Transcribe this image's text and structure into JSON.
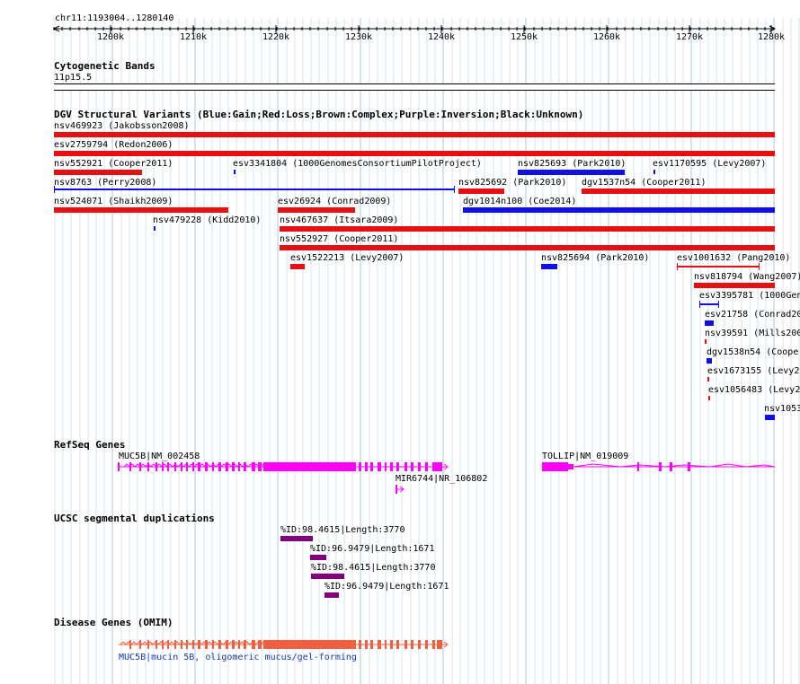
{
  "ruler": {
    "location": "chr11:1193004..1280140",
    "ticks": [
      "1200k",
      "1210k",
      "1220k",
      "1230k",
      "1240k",
      "1250k",
      "1260k",
      "1270k",
      "1280k"
    ]
  },
  "cyto": {
    "title": "Cytogenetic Bands",
    "band": "11p15.5"
  },
  "dgv": {
    "title": "DGV Structural Variants (Blue:Gain;Red:Loss;Brown:Complex;Purple:Inversion;Black:Unknown)",
    "colors": {
      "gain": "#1010e6",
      "loss": "#e61010"
    },
    "features": [
      {
        "label": "nsv469923 (Jakobsson2008)",
        "type": "loss"
      },
      {
        "label": "esv2759794 (Redon2006)",
        "type": "loss"
      },
      {
        "label": "nsv552921 (Cooper2011)",
        "type": "loss"
      },
      {
        "label": "esv3341804 (1000GenomesConsortiumPilotProject)",
        "type": "gain"
      },
      {
        "label": "nsv825693 (Park2010)",
        "type": "gain"
      },
      {
        "label": "esv1170595 (Levy2007)",
        "type": "gain"
      },
      {
        "label": "nsv8763 (Perry2008)",
        "type": "gain"
      },
      {
        "label": "nsv825692 (Park2010)",
        "type": "loss"
      },
      {
        "label": "dgv1537n54 (Cooper2011)",
        "type": "loss"
      },
      {
        "label": "nsv524071 (Shaikh2009)",
        "type": "loss"
      },
      {
        "label": "esv26924 (Conrad2009)",
        "type": "loss"
      },
      {
        "label": "dgv1014n100 (Coe2014)",
        "type": "gain"
      },
      {
        "label": "nsv479228 (Kidd2010)",
        "type": "gain"
      },
      {
        "label": "nsv467637 (Itsara2009)",
        "type": "loss"
      },
      {
        "label": "nsv552927 (Cooper2011)",
        "type": "loss"
      },
      {
        "label": "esv1522213 (Levy2007)",
        "type": "loss"
      },
      {
        "label": "nsv825694 (Park2010)",
        "type": "gain"
      },
      {
        "label": "esv1001632 (Pang2010)",
        "type": "loss"
      },
      {
        "label": "nsv818794 (Wang2007)",
        "type": "loss"
      },
      {
        "label": "esv3395781 (1000Gen",
        "type": "gain"
      },
      {
        "label": "esv21758 (Conrad20",
        "type": "gain"
      },
      {
        "label": "nsv39591 (Mills200",
        "type": "loss"
      },
      {
        "label": "dgv1538n54 (Cooper",
        "type": "gain"
      },
      {
        "label": "esv1673155 (Levy20",
        "type": "loss"
      },
      {
        "label": "esv1056483 (Levy2",
        "type": "loss"
      },
      {
        "label": "nsv1053",
        "type": "gain"
      }
    ]
  },
  "refseq": {
    "title": "RefSeq Genes",
    "color": "#ff00ff",
    "genes": [
      "MUC5B|NM_002458",
      "MIR6744|NR_106802",
      "TOLLIP|NM_019009"
    ]
  },
  "segdup": {
    "title": "UCSC segmental duplications",
    "color": "#800080",
    "items": [
      "%ID:98.4615|Length:3770",
      "%ID:96.9479|Length:1671",
      "%ID:98.4615|Length:3770",
      "%ID:96.9479|Length:1671"
    ]
  },
  "omim": {
    "title": "Disease Genes (OMIM)",
    "color": "#f06040",
    "genes": [
      "MUC5B|mucin 5B, oligomeric mucus/gel-forming"
    ]
  }
}
